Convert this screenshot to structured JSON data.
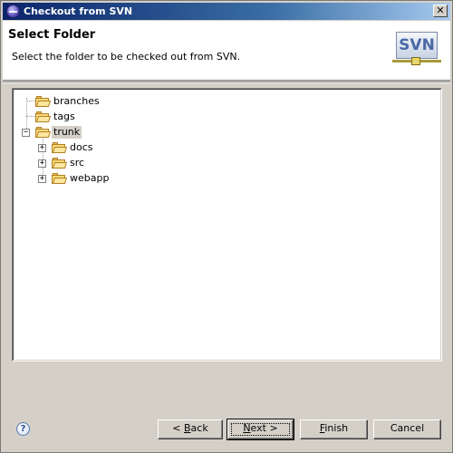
{
  "window": {
    "title": "Checkout from SVN",
    "close_label": "✕"
  },
  "banner": {
    "title": "Select Folder",
    "description": "Select the folder to be checked out from SVN.",
    "logo_text": "SVN"
  },
  "tree": {
    "items": [
      {
        "label": "branches",
        "expanded": false,
        "selected": false
      },
      {
        "label": "tags",
        "expanded": false,
        "selected": false
      },
      {
        "label": "trunk",
        "expanded": true,
        "selected": true
      },
      {
        "label": "docs",
        "expanded": false,
        "selected": false
      },
      {
        "label": "src",
        "expanded": false,
        "selected": false
      },
      {
        "label": "webapp",
        "expanded": false,
        "selected": false
      }
    ],
    "expander_collapsed": "+",
    "expander_expanded": "−"
  },
  "footer": {
    "help_label": "?",
    "back_prefix": "< ",
    "back_mnemonic": "B",
    "back_rest": "ack",
    "next_mnemonic": "N",
    "next_rest": "ext >",
    "finish_mnemonic": "F",
    "finish_rest": "inish",
    "cancel_label": "Cancel"
  },
  "colors": {
    "titlebar_start": "#0a246a",
    "titlebar_end": "#a6caf0",
    "dialog_bg": "#d4d0c8",
    "folder": "#fbd97a"
  }
}
